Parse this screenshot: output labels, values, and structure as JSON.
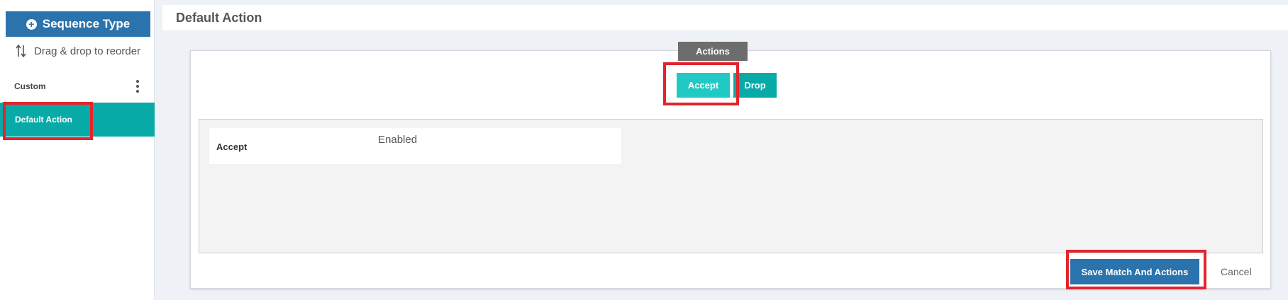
{
  "sidebar": {
    "sequence_type_label": "Sequence Type",
    "drag_hint": "Drag & drop to reorder",
    "custom_label": "Custom",
    "selected_item": "Default Action"
  },
  "header": {
    "title": "Default Action"
  },
  "actions": {
    "tab_label": "Actions",
    "accept_label": "Accept",
    "drop_label": "Drop"
  },
  "content": {
    "rows": [
      {
        "name": "Accept",
        "status": "Enabled"
      }
    ]
  },
  "footer": {
    "save_label": "Save Match And Actions",
    "cancel_label": "Cancel"
  },
  "colors": {
    "primary_blue": "#2b73ad",
    "teal": "#07aaa6",
    "teal_light": "#21c9c4",
    "highlight_red": "#e3242b"
  }
}
